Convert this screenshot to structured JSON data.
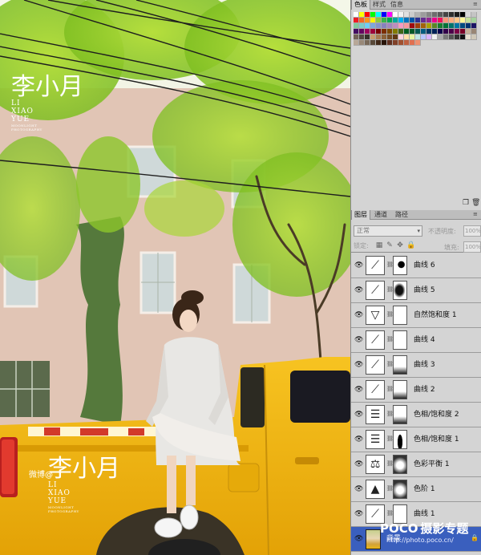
{
  "colors": {
    "panel_bg": "#d4d4d4",
    "selected_layer": "#3a5fbe",
    "truck_yellow": "#efb00c"
  },
  "watermark": {
    "name_cn": "李小月",
    "pinyin": [
      "LI",
      "XIAO",
      "YUE"
    ],
    "sub1": "MOONLIGHT",
    "sub2": "PHOTOGRAPHY",
    "weibo": "微博@"
  },
  "swatches_panel": {
    "tabs": [
      "色板",
      "样式",
      "信息"
    ],
    "menu_icon": "panel-menu-icon",
    "palette": [
      "#ffffff",
      "#ffff00",
      "#ff0000",
      "#00ff00",
      "#00ffff",
      "#0000ff",
      "#ff00ff",
      "#ffffff",
      "#f2f2f2",
      "#e0e0e0",
      "#cccccc",
      "#b3b3b3",
      "#9c9c9c",
      "#858585",
      "#6e6e6e",
      "#595959",
      "#444444",
      "#2e2e2e",
      "#1a1a1a",
      "#000000",
      "#d8d8d8",
      "#c4c4c4",
      "#ed1c24",
      "#f26522",
      "#f7941d",
      "#fff200",
      "#8dc63f",
      "#39b54a",
      "#00a651",
      "#00a99d",
      "#00aeef",
      "#0072bc",
      "#0054a6",
      "#2e3192",
      "#662d91",
      "#92278f",
      "#ec008c",
      "#ed145b",
      "#f69679",
      "#f9ad81",
      "#fdc689",
      "#fff799",
      "#c4df9b",
      "#a3d39c",
      "#82ca9c",
      "#7accc8",
      "#6dcff6",
      "#7da7d9",
      "#8393ca",
      "#8781bd",
      "#a186be",
      "#bd8cbf",
      "#f49ac1",
      "#f5989d",
      "#9e0b0f",
      "#a0410d",
      "#a36209",
      "#aba000",
      "#598527",
      "#1a7b30",
      "#007236",
      "#00746b",
      "#0076a3",
      "#004b80",
      "#003471",
      "#1b1464",
      "#440e62",
      "#630460",
      "#9e005d",
      "#9e0039",
      "#790000",
      "#7b2e00",
      "#7d4900",
      "#827b00",
      "#406618",
      "#005e20",
      "#005826",
      "#005952",
      "#005b7f",
      "#003663",
      "#002157",
      "#0d004c",
      "#32004b",
      "#4b0049",
      "#7b0046",
      "#7a0026",
      "#c7b299",
      "#998675",
      "#736357",
      "#534741",
      "#37302a",
      "#c69c6d",
      "#a67c52",
      "#8c6239",
      "#754c24",
      "#603913",
      "#ffd5e0",
      "#ffe0a8",
      "#e6f5a0",
      "#c1e6e6",
      "#b7c7ff",
      "#d9b3ff",
      "#f0f0f0",
      "#aaaaaa",
      "#7a7a7a",
      "#555555",
      "#333333",
      "#111111",
      "#e8e0d0",
      "#d0c8b8",
      "#b8a898",
      "#988878",
      "#786858",
      "#584838",
      "#402818",
      "#281408",
      "#603020",
      "#804028",
      "#a05030",
      "#c06040",
      "#e07050",
      "#f09070"
    ]
  },
  "layers_panel": {
    "tabs": [
      "图层",
      "通道",
      "路径"
    ],
    "blend_mode": "正常",
    "opacity_label": "不透明度:",
    "opacity_value": "100%",
    "lock_label": "锁定:",
    "fill_label": "填充:",
    "fill_value": "100%",
    "layers": [
      {
        "name": "曲线 6",
        "type": "curves",
        "mask": "dark-spot",
        "selected": false
      },
      {
        "name": "曲线 5",
        "type": "curves",
        "mask": "dark-blob",
        "selected": false
      },
      {
        "name": "自然饱和度 1",
        "type": "vibrance",
        "mask": "white",
        "selected": false
      },
      {
        "name": "曲线 4",
        "type": "curves",
        "mask": "white",
        "selected": false
      },
      {
        "name": "曲线 3",
        "type": "curves",
        "mask": "white-bottom-dark",
        "selected": false
      },
      {
        "name": "曲线 2",
        "type": "curves",
        "mask": "white-bottom-dark",
        "selected": false
      },
      {
        "name": "色相/饱和度 2",
        "type": "hue-sat",
        "mask": "white-bottom-dark",
        "selected": false
      },
      {
        "name": "色相/饱和度 1",
        "type": "hue-sat",
        "mask": "figure",
        "selected": false
      },
      {
        "name": "色彩平衡 1",
        "type": "color-balance",
        "mask": "white-spot",
        "selected": false
      },
      {
        "name": "色阶 1",
        "type": "levels",
        "mask": "white-spot",
        "selected": false
      },
      {
        "name": "曲线 1",
        "type": "curves",
        "mask": "white",
        "selected": false
      },
      {
        "name": "背景",
        "type": "background",
        "mask": "none",
        "selected": true
      }
    ]
  },
  "poco": {
    "brand": "POCO",
    "title": "摄影专题",
    "url": "http://photo.poco.cn/"
  }
}
